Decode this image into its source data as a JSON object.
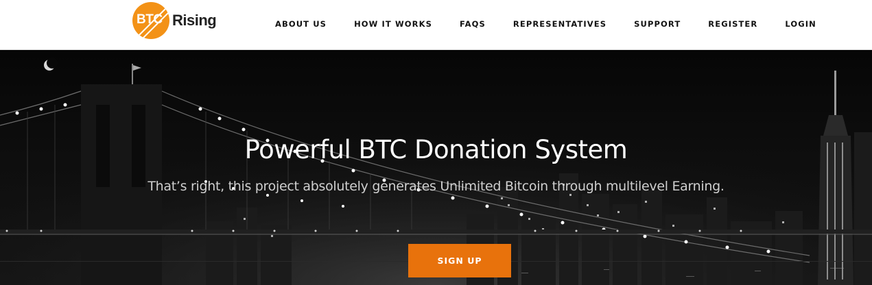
{
  "brand": {
    "logo_mark": "BTC",
    "logo_word": "Rising",
    "accent_color": "#f39217"
  },
  "nav": {
    "items": [
      {
        "label": "ABOUT US"
      },
      {
        "label": "HOW IT WORKS"
      },
      {
        "label": "FAQS"
      },
      {
        "label": "REPRESENTATIVES"
      },
      {
        "label": "SUPPORT"
      },
      {
        "label": "REGISTER"
      },
      {
        "label": "LOGIN"
      }
    ]
  },
  "hero": {
    "title": "Powerful BTC Donation System",
    "subtitle": "That’s right, this project absolutely generates Unlimited Bitcoin through multilevel Earning.",
    "cta_label": "SIGN UP",
    "cta_color": "#e8720c",
    "background_image": "night-city-bridge-skyline"
  }
}
